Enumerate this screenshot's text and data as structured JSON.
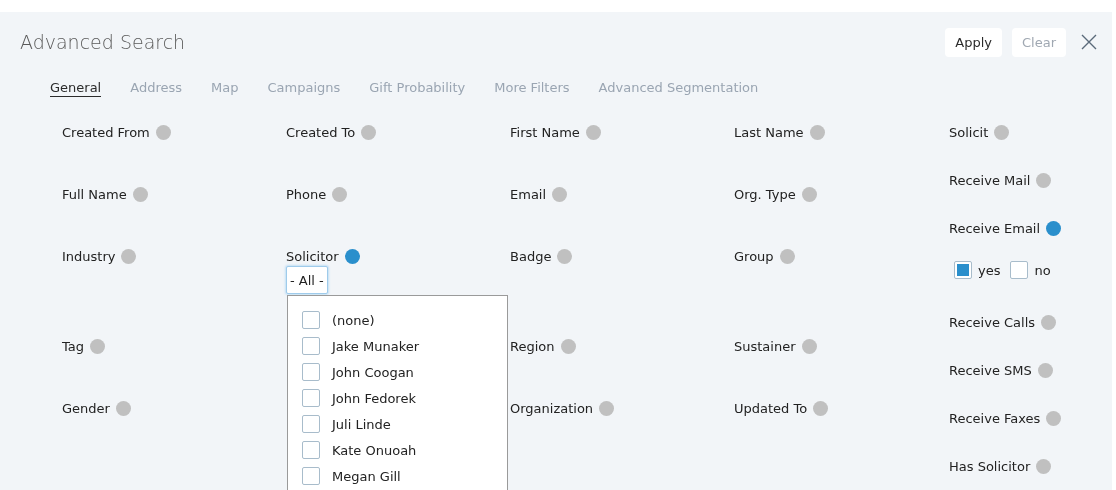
{
  "header": {
    "title": "Advanced Search",
    "buttons": [
      {
        "label": "Apply",
        "disabled": false
      },
      {
        "label": "Clear",
        "disabled": true
      }
    ]
  },
  "tabs": [
    {
      "label": "General",
      "selected": true
    },
    {
      "label": "Address",
      "selected": false
    },
    {
      "label": "Map",
      "selected": false
    },
    {
      "label": "Campaigns",
      "selected": false
    },
    {
      "label": "Gift Probability",
      "selected": false
    },
    {
      "label": "More Filters",
      "selected": false
    },
    {
      "label": "Advanced Segmentation",
      "selected": false
    }
  ],
  "filter_columns": [
    [
      {
        "label": "Created From",
        "active": false
      },
      {
        "label": "Full Name",
        "active": false
      },
      {
        "label": "Industry",
        "active": false
      },
      {
        "label": "Tag",
        "active": false
      },
      {
        "label": "Gender",
        "active": false
      }
    ],
    [
      {
        "label": "Created To",
        "active": false
      },
      {
        "label": "Phone",
        "active": false
      },
      {
        "label": "Solicitor",
        "active": true,
        "select": {
          "value": "- All -",
          "expanded": true,
          "options": [
            {
              "label": "(none)",
              "checked": false
            },
            {
              "label": "Jake Munaker",
              "checked": false
            },
            {
              "label": "John Coogan",
              "checked": false
            },
            {
              "label": "John Fedorek",
              "checked": false
            },
            {
              "label": "Juli Linde",
              "checked": false
            },
            {
              "label": "Kate Onuoah",
              "checked": false
            },
            {
              "label": "Megan Gill",
              "checked": false
            }
          ]
        }
      }
    ],
    [
      {
        "label": "First Name",
        "active": false
      },
      {
        "label": "Email",
        "active": false
      },
      {
        "label": "Badge",
        "active": false
      },
      {
        "label": "Region",
        "active": false
      },
      {
        "label": "Organization",
        "active": false
      }
    ],
    [
      {
        "label": "Last Name",
        "active": false
      },
      {
        "label": "Org. Type",
        "active": false
      },
      {
        "label": "Group",
        "active": false
      },
      {
        "label": "Sustainer",
        "active": false
      },
      {
        "label": "Updated To",
        "active": false
      }
    ]
  ],
  "flags": [
    {
      "label": "Solicit",
      "active": false
    },
    {
      "label": "Receive Mail",
      "active": false
    },
    {
      "label": "Receive Email",
      "active": true,
      "choices": [
        {
          "label": "yes",
          "checked": true
        },
        {
          "label": "no",
          "checked": false
        }
      ]
    },
    {
      "label": "Receive Calls",
      "active": false
    },
    {
      "label": "Receive SMS",
      "active": false
    },
    {
      "label": "Receive Faxes",
      "active": false
    },
    {
      "label": "Has Solicitor",
      "active": false
    }
  ]
}
